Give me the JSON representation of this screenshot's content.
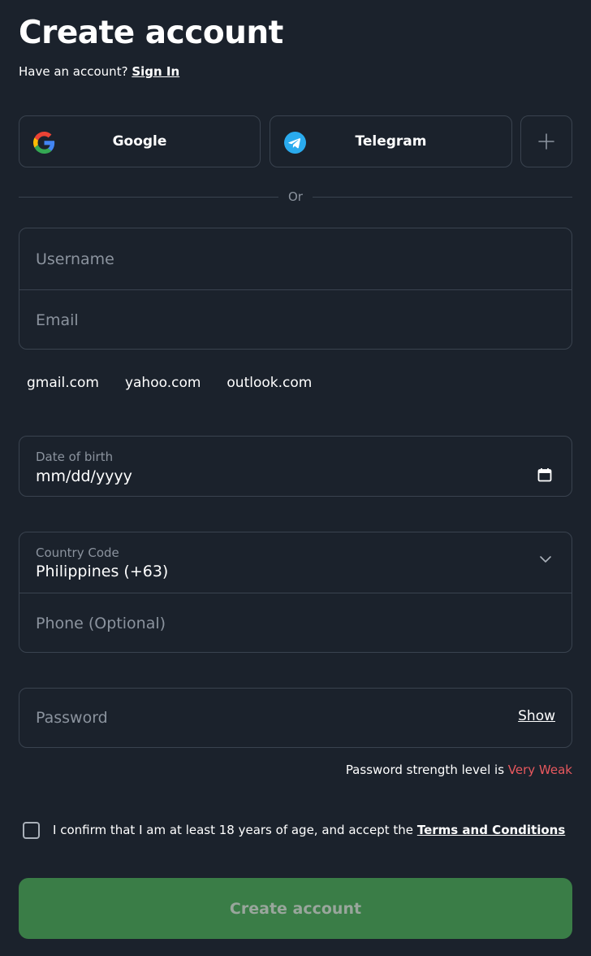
{
  "header": {
    "title": "Create account",
    "have_account_text": "Have an account?",
    "sign_in_label": "Sign In"
  },
  "social": {
    "google_label": "Google",
    "telegram_label": "Telegram",
    "google_icon": "google-icon",
    "telegram_icon": "telegram-icon",
    "more_icon": "plus-icon"
  },
  "divider": {
    "text": "Or"
  },
  "fields": {
    "username_placeholder": "Username",
    "email_placeholder": "Email",
    "email_domains": [
      "gmail.com",
      "yahoo.com",
      "outlook.com"
    ],
    "dob_label": "Date of birth",
    "dob_value": "mm/dd/yyyy",
    "country_code_label": "Country Code",
    "country_code_value": "Philippines (+63)",
    "phone_placeholder": "Phone (Optional)",
    "password_placeholder": "Password",
    "password_show_label": "Show"
  },
  "password_strength": {
    "prefix": "Password strength level is",
    "level": "Very Weak",
    "level_color": "#e8585e"
  },
  "terms": {
    "text": "I confirm that I am at least 18 years of age, and accept the",
    "link_label": "Terms and Conditions",
    "checked": false
  },
  "submit": {
    "label": "Create account",
    "color": "#3a7d47"
  },
  "colors": {
    "background": "#1b222c",
    "border": "#3a434f",
    "muted_text": "#8b939e"
  }
}
